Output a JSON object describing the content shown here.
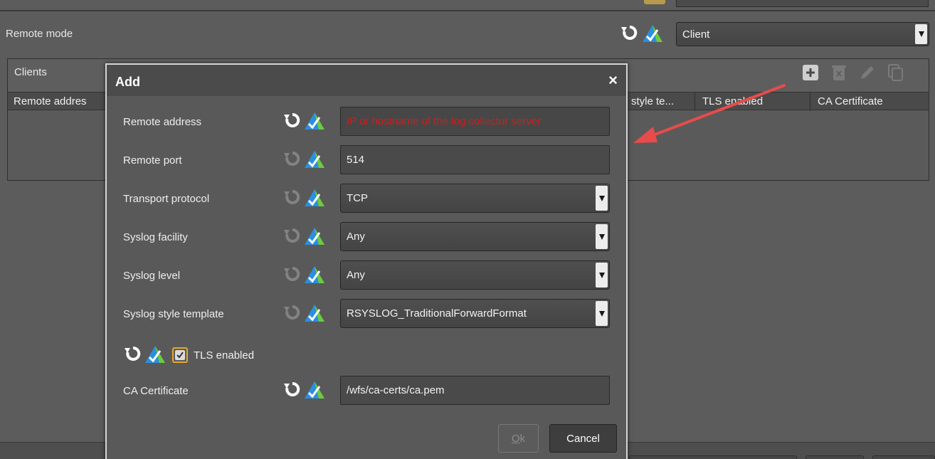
{
  "background": {
    "remote_mode": {
      "label": "Remote mode",
      "value": "Client"
    },
    "clients": {
      "title": "Clients",
      "columns": [
        "Remote addres",
        "style te...",
        "TLS enabled",
        "CA Certificate"
      ]
    }
  },
  "dialog": {
    "title": "Add",
    "close_glyph": "×",
    "fields": {
      "remote_address": {
        "label": "Remote address",
        "placeholder": "IP or hostname of the log collector server"
      },
      "remote_port": {
        "label": "Remote port",
        "value": "514"
      },
      "transport_protocol": {
        "label": "Transport protocol",
        "value": "TCP"
      },
      "syslog_facility": {
        "label": "Syslog facility",
        "value": "Any"
      },
      "syslog_level": {
        "label": "Syslog level",
        "value": "Any"
      },
      "syslog_style_template": {
        "label": "Syslog style template",
        "value": "RSYSLOG_TraditionalForwardFormat"
      },
      "tls_enabled": {
        "label": "TLS enabled",
        "checked": true
      },
      "ca_certificate": {
        "label": "CA Certificate",
        "value": "/wfs/ca-certs/ca.pem"
      }
    },
    "buttons": {
      "ok_mnemonic": "O",
      "ok_rest": "k",
      "cancel": "Cancel"
    }
  },
  "colors": {
    "placeholder_red": "#d51b1b",
    "checkbox_border": "#e3a92e",
    "annotation_arrow": "#e84b4b",
    "icon_blue": "#2a8fe0",
    "icon_green": "#6ecb3c"
  },
  "icons": [
    "reset-icon",
    "default-value-icon",
    "add-icon",
    "delete-icon",
    "edit-icon",
    "copy-icon",
    "close-icon",
    "dropdown-arrow-icon",
    "checkbox-tick-icon"
  ]
}
